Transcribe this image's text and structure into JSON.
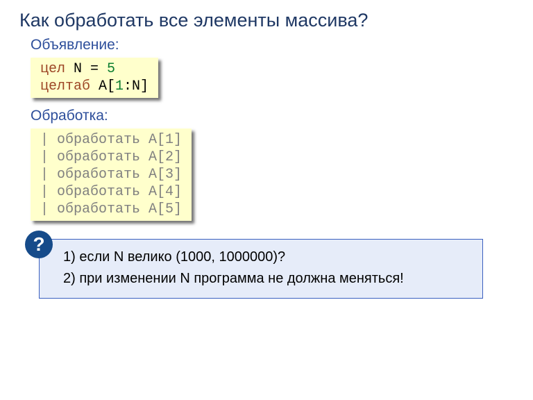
{
  "title": "Как обработать все элементы массива?",
  "section_declare": "Объявление:",
  "section_process": "Обработка:",
  "decl": {
    "kw_int": "цел ",
    "var_n": "N",
    "eq": " = ",
    "num5": "5",
    "kw_arr": "целтаб ",
    "arr_a": "A[",
    "num1": "1",
    "colon_n": ":N]"
  },
  "proc": {
    "bar": "| ",
    "txt": "обработать ",
    "a1": "A[1]",
    "a2": "A[2]",
    "a3": "A[3]",
    "a4": "A[4]",
    "a5": "A[5]"
  },
  "qmark": "?",
  "q1": "1) если N велико (1000, 1000000)?",
  "q2": "2) при изменении N программа не должна меняться!"
}
